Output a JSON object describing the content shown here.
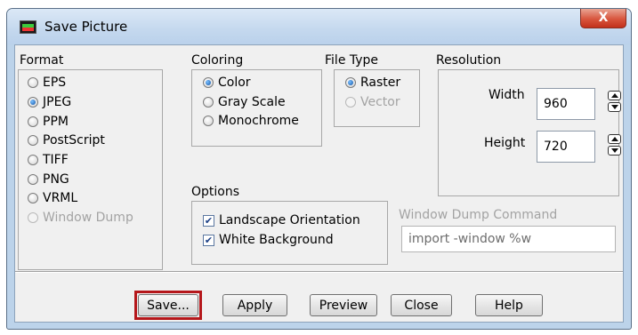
{
  "window": {
    "title": "Save Picture",
    "close_label": "X"
  },
  "format": {
    "label": "Format",
    "options": [
      {
        "label": "EPS",
        "selected": false,
        "enabled": true
      },
      {
        "label": "JPEG",
        "selected": true,
        "enabled": true
      },
      {
        "label": "PPM",
        "selected": false,
        "enabled": true
      },
      {
        "label": "PostScript",
        "selected": false,
        "enabled": true
      },
      {
        "label": "TIFF",
        "selected": false,
        "enabled": true
      },
      {
        "label": "PNG",
        "selected": false,
        "enabled": true
      },
      {
        "label": "VRML",
        "selected": false,
        "enabled": true
      },
      {
        "label": "Window Dump",
        "selected": false,
        "enabled": false
      }
    ]
  },
  "coloring": {
    "label": "Coloring",
    "options": [
      {
        "label": "Color",
        "selected": true,
        "enabled": true
      },
      {
        "label": "Gray Scale",
        "selected": false,
        "enabled": true
      },
      {
        "label": "Monochrome",
        "selected": false,
        "enabled": true
      }
    ]
  },
  "file_type": {
    "label": "File Type",
    "options": [
      {
        "label": "Raster",
        "selected": true,
        "enabled": true
      },
      {
        "label": "Vector",
        "selected": false,
        "enabled": false
      }
    ]
  },
  "resolution": {
    "label": "Resolution",
    "width_label": "Width",
    "width_value": "960",
    "height_label": "Height",
    "height_value": "720"
  },
  "options": {
    "label": "Options",
    "landscape_label": "Landscape Orientation",
    "landscape_checked": true,
    "white_bg_label": "White Background",
    "white_bg_checked": true
  },
  "window_dump": {
    "label": "Window Dump Command",
    "value": "import -window %w"
  },
  "buttons": {
    "save": "Save...",
    "apply": "Apply",
    "preview": "Preview",
    "close": "Close",
    "help": "Help"
  },
  "colors": {
    "highlight": "#b5171b",
    "titlebar": "#c4d8ee",
    "close": "#d8553d"
  }
}
